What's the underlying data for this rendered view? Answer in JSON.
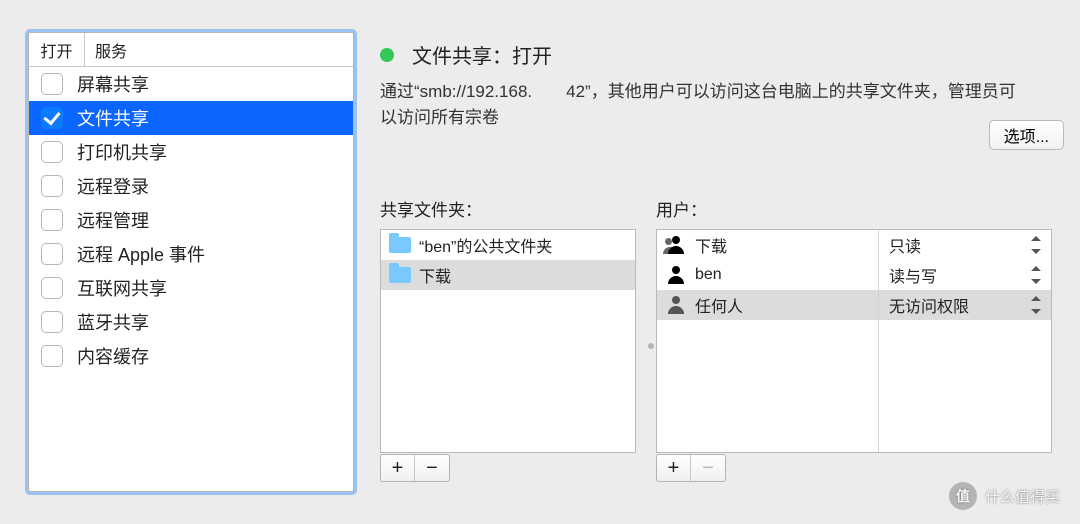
{
  "services": {
    "col_on": "打开",
    "col_name": "服务",
    "items": [
      {
        "label": "屏幕共享",
        "checked": false,
        "selected": false
      },
      {
        "label": "文件共享",
        "checked": true,
        "selected": true
      },
      {
        "label": "打印机共享",
        "checked": false,
        "selected": false
      },
      {
        "label": "远程登录",
        "checked": false,
        "selected": false
      },
      {
        "label": "远程管理",
        "checked": false,
        "selected": false
      },
      {
        "label": "远程 Apple 事件",
        "checked": false,
        "selected": false
      },
      {
        "label": "互联网共享",
        "checked": false,
        "selected": false
      },
      {
        "label": "蓝牙共享",
        "checked": false,
        "selected": false
      },
      {
        "label": "内容缓存",
        "checked": false,
        "selected": false
      }
    ]
  },
  "status": {
    "title": "文件共享：打开",
    "dot_color": "#34c759",
    "description": "通过“smb://192.168.  42”，其他用户可以访问这台电脑上的共享文件夹，管理员可以访问所有宗卷"
  },
  "options_button": "选项...",
  "folders": {
    "section_label": "共享文件夹：",
    "items": [
      {
        "label": "“ben”的公共文件夹",
        "selected": false
      },
      {
        "label": "下载",
        "selected": true
      }
    ]
  },
  "users": {
    "section_label": "用户：",
    "items": [
      {
        "name": "下载",
        "icon": "group",
        "perm": "只读",
        "selected": false
      },
      {
        "name": "ben",
        "icon": "single",
        "perm": "读与写",
        "selected": false
      },
      {
        "name": "任何人",
        "icon": "everyone",
        "perm": "无访问权限",
        "selected": true
      }
    ]
  },
  "pm": {
    "plus": "+",
    "minus": "−"
  },
  "watermark": {
    "badge": "值",
    "text": "什么值得买"
  }
}
